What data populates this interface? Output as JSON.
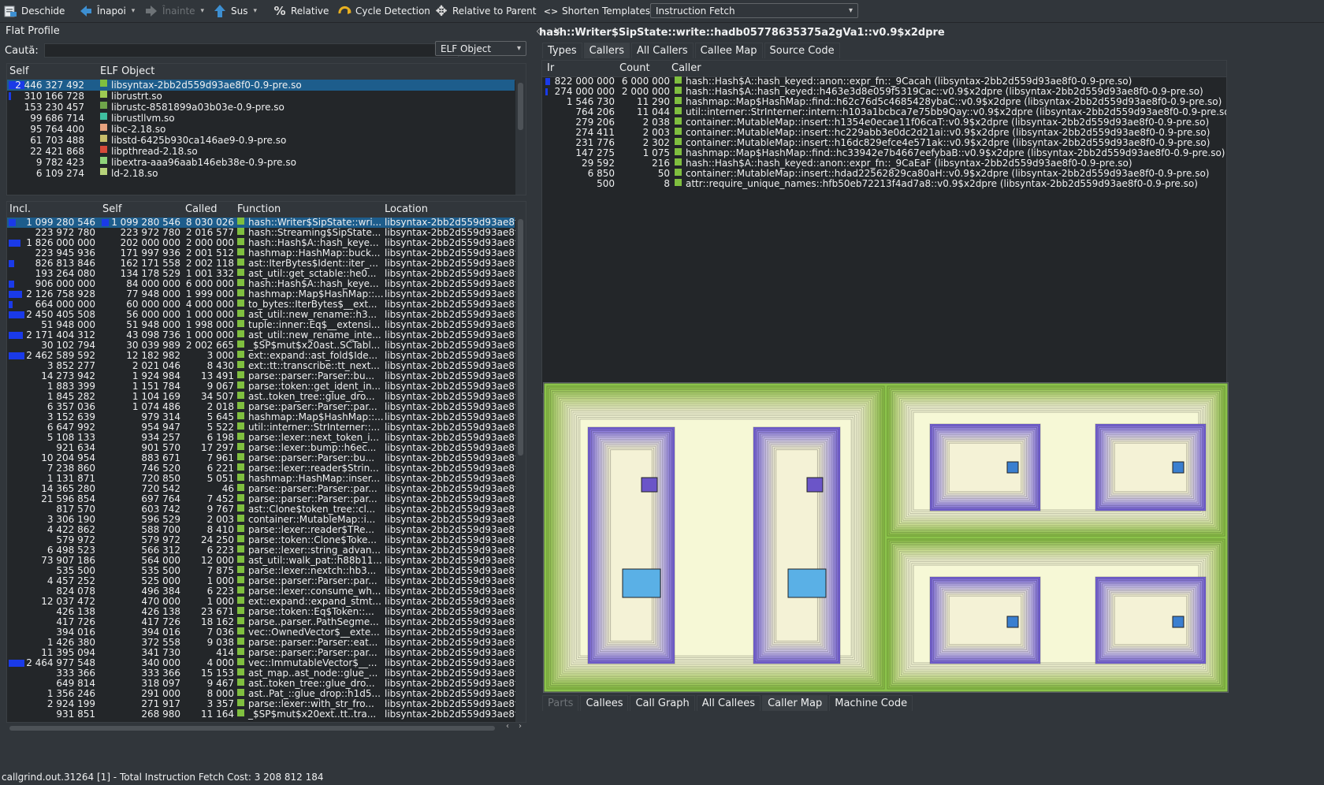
{
  "toolbar": {
    "open": "Deschide",
    "back": "Înapoi",
    "forward": "Înainte",
    "up": "Sus",
    "relative": "Relative",
    "cycle": "Cycle Detection",
    "relparent": "Relative to Parent",
    "shorten": "Shorten Templates",
    "event_type": "Instruction Fetch"
  },
  "left": {
    "title": "Flat Profile",
    "search_label": "Caută:",
    "search_value": "",
    "group_combo": "ELF Object",
    "objects_header": {
      "self": "Self",
      "obj": "ELF Object"
    },
    "objects": [
      {
        "self": "2 446 327 492",
        "name": "libsyntax-2bb2d559d93ae8f0-0.9-pre.so",
        "color": "#7fbf3f",
        "bar": 0.76
      },
      {
        "self": "310 166 728",
        "name": "librustrt.so",
        "color": "#9ecb52",
        "bar": 0.1
      },
      {
        "self": "153 230 457",
        "name": "librustc-8581899a03b03e-0.9-pre.so",
        "color": "#6fa44a",
        "bar": 0
      },
      {
        "self": "99 686 714",
        "name": "librustllvm.so",
        "color": "#3fbfa0",
        "bar": 0
      },
      {
        "self": "95 764 400",
        "name": "libc-2.18.so",
        "color": "#e6a27f",
        "bar": 0
      },
      {
        "self": "61 703 488",
        "name": "libstd-6425b930ca146ae9-0.9-pre.so",
        "color": "#c7bd6b",
        "bar": 0
      },
      {
        "self": "22 421 868",
        "name": "libpthread-2.18.so",
        "color": "#d64a3a",
        "bar": 0
      },
      {
        "self": "9 782 423",
        "name": "libextra-aaa96aab146eb38e-0.9-pre.so",
        "color": "#8fd47a",
        "bar": 0
      },
      {
        "self": "6 109 274",
        "name": "ld-2.18.so",
        "color": "#b7d37a",
        "bar": 0
      }
    ],
    "functions_header": {
      "incl": "Incl.",
      "self": "Self",
      "called": "Called",
      "func": "Function",
      "loc": "Location"
    },
    "functions": [
      {
        "incl": "1 099 280 546",
        "self": "1 099 280 546",
        "called": "8 030 026",
        "func": "hash::Writer$SipState::wri...",
        "loc": "libsyntax-2bb2d559d93ae8f",
        "ib": 0.34,
        "sb": 0.34
      },
      {
        "incl": "223 972 780",
        "self": "223 972 780",
        "called": "2 016 577",
        "func": "hash::Streaming$SipState...",
        "loc": "libsyntax-2bb2d559d93ae8f",
        "ib": 0,
        "sb": 0
      },
      {
        "incl": "1 826 000 000",
        "self": "202 000 000",
        "called": "2 000 000",
        "func": "hash::Hash$A::hash_keye...",
        "loc": "libsyntax-2bb2d559d93ae8f",
        "ib": 0.57,
        "sb": 0
      },
      {
        "incl": "223 945 936",
        "self": "171 997 936",
        "called": "2 001 512",
        "func": "hashmap::HashMap::buck...",
        "loc": "libsyntax-2bb2d559d93ae8f",
        "ib": 0,
        "sb": 0
      },
      {
        "incl": "826 813 846",
        "self": "162 171 558",
        "called": "2 002 118",
        "func": "ast::IterBytes$Ident::iter_...",
        "loc": "libsyntax-2bb2d559d93ae8f",
        "ib": 0.26,
        "sb": 0
      },
      {
        "incl": "193 264 080",
        "self": "134 178 529",
        "called": "1 001 332",
        "func": "ast_util::get_sctable::he0...",
        "loc": "libsyntax-2bb2d559d93ae8f",
        "ib": 0,
        "sb": 0
      },
      {
        "incl": "906 000 000",
        "self": "84 000 000",
        "called": "6 000 000",
        "func": "hash::Hash$A::hash_keye...",
        "loc": "libsyntax-2bb2d559d93ae8f",
        "ib": 0.28,
        "sb": 0
      },
      {
        "incl": "2 126 758 928",
        "self": "77 948 000",
        "called": "1 999 000",
        "func": "hashmap::Map$HashMap::...",
        "loc": "libsyntax-2bb2d559d93ae8f",
        "ib": 0.66,
        "sb": 0
      },
      {
        "incl": "664 000 000",
        "self": "60 000 000",
        "called": "4 000 000",
        "func": "to_bytes::IterBytes$__ext...",
        "loc": "libsyntax-2bb2d559d93ae8f",
        "ib": 0.21,
        "sb": 0
      },
      {
        "incl": "2 450 405 508",
        "self": "56 000 000",
        "called": "1 000 000",
        "func": "ast_util::new_rename::h3...",
        "loc": "libsyntax-2bb2d559d93ae8f",
        "ib": 0.76,
        "sb": 0
      },
      {
        "incl": "51 948 000",
        "self": "51 948 000",
        "called": "1 998 000",
        "func": "tuple::inner::Eq$__extensi...",
        "loc": "libsyntax-2bb2d559d93ae8f",
        "ib": 0,
        "sb": 0
      },
      {
        "incl": "2 171 404 312",
        "self": "43 098 736",
        "called": "1 000 000",
        "func": "ast_util::new_rename_inte...",
        "loc": "libsyntax-2bb2d559d93ae8f",
        "ib": 0.68,
        "sb": 0
      },
      {
        "incl": "30 102 794",
        "self": "30 039 989",
        "called": "2 002 665",
        "func": "_$SP$mut$x20ast..SCTabl...",
        "loc": "libsyntax-2bb2d559d93ae8f",
        "ib": 0,
        "sb": 0
      },
      {
        "incl": "2 462 589 592",
        "self": "12 182 982",
        "called": "3 000",
        "func": "ext::expand::ast_fold$Ide...",
        "loc": "libsyntax-2bb2d559d93ae8f",
        "ib": 0.77,
        "sb": 0
      },
      {
        "incl": "3 852 277",
        "self": "2 021 046",
        "called": "8 430",
        "func": "ext::tt::transcribe::tt_next...",
        "loc": "libsyntax-2bb2d559d93ae8f",
        "ib": 0,
        "sb": 0
      },
      {
        "incl": "14 273 942",
        "self": "1 924 984",
        "called": "13 491",
        "func": "parse::parser::Parser::bu...",
        "loc": "libsyntax-2bb2d559d93ae8f",
        "ib": 0,
        "sb": 0
      },
      {
        "incl": "1 883 399",
        "self": "1 151 784",
        "called": "9 067",
        "func": "parse::token::get_ident_in...",
        "loc": "libsyntax-2bb2d559d93ae8f",
        "ib": 0,
        "sb": 0
      },
      {
        "incl": "1 845 282",
        "self": "1 104 169",
        "called": "34 507",
        "func": "ast..token_tree::glue_dro...",
        "loc": "libsyntax-2bb2d559d93ae8f",
        "ib": 0,
        "sb": 0
      },
      {
        "incl": "6 357 036",
        "self": "1 074 486",
        "called": "2 018",
        "func": "parse::parser::Parser::par...",
        "loc": "libsyntax-2bb2d559d93ae8f",
        "ib": 0,
        "sb": 0
      },
      {
        "incl": "3 152 639",
        "self": "979 314",
        "called": "5 645",
        "func": "hashmap::Map$HashMap::...",
        "loc": "libsyntax-2bb2d559d93ae8f",
        "ib": 0,
        "sb": 0
      },
      {
        "incl": "6 647 992",
        "self": "954 947",
        "called": "5 522",
        "func": "util::interner::StrInterner::...",
        "loc": "libsyntax-2bb2d559d93ae8f",
        "ib": 0,
        "sb": 0
      },
      {
        "incl": "5 108 133",
        "self": "934 257",
        "called": "6 198",
        "func": "parse::lexer::next_token_i...",
        "loc": "libsyntax-2bb2d559d93ae8f",
        "ib": 0,
        "sb": 0
      },
      {
        "incl": "921 634",
        "self": "901 570",
        "called": "17 297",
        "func": "parse::lexer::bump::h6ec...",
        "loc": "libsyntax-2bb2d559d93ae8f",
        "ib": 0,
        "sb": 0
      },
      {
        "incl": "10 204 954",
        "self": "883 671",
        "called": "7 961",
        "func": "parse::parser::Parser::bu...",
        "loc": "libsyntax-2bb2d559d93ae8f",
        "ib": 0,
        "sb": 0
      },
      {
        "incl": "7 238 860",
        "self": "746 520",
        "called": "6 221",
        "func": "parse::lexer::reader$Strin...",
        "loc": "libsyntax-2bb2d559d93ae8f",
        "ib": 0,
        "sb": 0
      },
      {
        "incl": "1 131 871",
        "self": "720 850",
        "called": "5 051",
        "func": "hashmap::HashMap::inser...",
        "loc": "libsyntax-2bb2d559d93ae8f",
        "ib": 0,
        "sb": 0
      },
      {
        "incl": "14 365 280",
        "self": "720 542",
        "called": "46",
        "func": "parse::parser::Parser::par...",
        "loc": "libsyntax-2bb2d559d93ae8f",
        "ib": 0,
        "sb": 0
      },
      {
        "incl": "21 596 854",
        "self": "697 764",
        "called": "7 452",
        "func": "parse::parser::Parser::par...",
        "loc": "libsyntax-2bb2d559d93ae8f",
        "ib": 0,
        "sb": 0
      },
      {
        "incl": "817 570",
        "self": "603 742",
        "called": "9 767",
        "func": "ast::Clone$token_tree::cl...",
        "loc": "libsyntax-2bb2d559d93ae8f",
        "ib": 0,
        "sb": 0
      },
      {
        "incl": "3 306 190",
        "self": "596 529",
        "called": "2 003",
        "func": "container::MutableMap::i...",
        "loc": "libsyntax-2bb2d559d93ae8f",
        "ib": 0,
        "sb": 0
      },
      {
        "incl": "4 422 862",
        "self": "588 700",
        "called": "8 410",
        "func": "parse::lexer::reader$TRe...",
        "loc": "libsyntax-2bb2d559d93ae8f",
        "ib": 0,
        "sb": 0
      },
      {
        "incl": "579 972",
        "self": "579 972",
        "called": "24 250",
        "func": "parse::token::Clone$Toke...",
        "loc": "libsyntax-2bb2d559d93ae8f",
        "ib": 0,
        "sb": 0
      },
      {
        "incl": "6 498 523",
        "self": "566 312",
        "called": "6 223",
        "func": "parse::lexer::string_advan...",
        "loc": "libsyntax-2bb2d559d93ae8f",
        "ib": 0,
        "sb": 0
      },
      {
        "incl": "73 907 186",
        "self": "564 000",
        "called": "12 000",
        "func": "ast_util::walk_pat::h88b11...",
        "loc": "libsyntax-2bb2d559d93ae8f",
        "ib": 0,
        "sb": 0
      },
      {
        "incl": "535 500",
        "self": "535 500",
        "called": "7 875",
        "func": "parse::lexer::nextch::hb3...",
        "loc": "libsyntax-2bb2d559d93ae8f",
        "ib": 0,
        "sb": 0
      },
      {
        "incl": "4 457 252",
        "self": "525 000",
        "called": "1 000",
        "func": "parse::parser::Parser::par...",
        "loc": "libsyntax-2bb2d559d93ae8f",
        "ib": 0,
        "sb": 0
      },
      {
        "incl": "824 078",
        "self": "496 384",
        "called": "6 223",
        "func": "parse::lexer::consume_wh...",
        "loc": "libsyntax-2bb2d559d93ae8f",
        "ib": 0,
        "sb": 0
      },
      {
        "incl": "12 037 472",
        "self": "470 000",
        "called": "1 000",
        "func": "ext::expand::expand_stmt...",
        "loc": "libsyntax-2bb2d559d93ae8f",
        "ib": 0,
        "sb": 0
      },
      {
        "incl": "426 138",
        "self": "426 138",
        "called": "23 671",
        "func": "parse::token::Eq$Token::...",
        "loc": "libsyntax-2bb2d559d93ae8f",
        "ib": 0,
        "sb": 0
      },
      {
        "incl": "417 726",
        "self": "417 726",
        "called": "18 162",
        "func": "parse..parser..PathSegme...",
        "loc": "libsyntax-2bb2d559d93ae8f",
        "ib": 0,
        "sb": 0
      },
      {
        "incl": "394 016",
        "self": "394 016",
        "called": "7 036",
        "func": "vec::OwnedVector$__exte...",
        "loc": "libsyntax-2bb2d559d93ae8f",
        "ib": 0,
        "sb": 0
      },
      {
        "incl": "1 426 380",
        "self": "372 558",
        "called": "9 038",
        "func": "parse::parser::Parser::eat...",
        "loc": "libsyntax-2bb2d559d93ae8f",
        "ib": 0,
        "sb": 0
      },
      {
        "incl": "11 395 094",
        "self": "341 730",
        "called": "414",
        "func": "parse::parser::Parser::par...",
        "loc": "libsyntax-2bb2d559d93ae8f",
        "ib": 0,
        "sb": 0
      },
      {
        "incl": "2 464 977 548",
        "self": "340 000",
        "called": "4 000",
        "func": "vec::ImmutableVector$__...",
        "loc": "libsyntax-2bb2d559d93ae8f",
        "ib": 0.77,
        "sb": 0
      },
      {
        "incl": "333 366",
        "self": "333 366",
        "called": "15 153",
        "func": "ast_map..ast_node::glue_...",
        "loc": "libsyntax-2bb2d559d93ae8f",
        "ib": 0,
        "sb": 0
      },
      {
        "incl": "649 814",
        "self": "318 097",
        "called": "9 467",
        "func": "ast..token_tree::glue_dro...",
        "loc": "libsyntax-2bb2d559d93ae8f",
        "ib": 0,
        "sb": 0
      },
      {
        "incl": "1 356 246",
        "self": "291 000",
        "called": "8 000",
        "func": "ast..Pat_::glue_drop::h1d5...",
        "loc": "libsyntax-2bb2d559d93ae8f",
        "ib": 0,
        "sb": 0
      },
      {
        "incl": "2 924 199",
        "self": "271 917",
        "called": "3 357",
        "func": "parse::lexer::with_str_fro...",
        "loc": "libsyntax-2bb2d559d93ae8f",
        "ib": 0,
        "sb": 0
      },
      {
        "incl": "931 851",
        "self": "268 980",
        "called": "11 164",
        "func": "_$SP$mut$x20ext..tt..tra...",
        "loc": "libsyntax-2bb2d559d93ae8f",
        "ib": 0,
        "sb": 0
      }
    ]
  },
  "right": {
    "title": "hash::Writer$SipState::write::hadb05778635375a2gVa1::v0.9$x2dpre",
    "top_tabs": [
      "Types",
      "Callers",
      "All Callers",
      "Callee Map",
      "Source Code"
    ],
    "top_active": 1,
    "callers_header": {
      "ir": "Ir",
      "count": "Count",
      "caller": "Caller"
    },
    "callers": [
      {
        "ir": "822 000 000",
        "count": "6 000 000",
        "caller": "hash::Hash$A::hash_keyed::anon::expr_fn::_9Cacah (libsyntax-2bb2d559d93ae8f0-0.9-pre.so)",
        "bar": 0.75
      },
      {
        "ir": "274 000 000",
        "count": "2 000 000",
        "caller": "hash::Hash$A::hash_keyed::h463e3d8e059f5319Cac::v0.9$x2dpre (libsyntax-2bb2d559d93ae8f0-0.9-pre.so)",
        "bar": 0.25
      },
      {
        "ir": "1 546 730",
        "count": "11 290",
        "caller": "hashmap::Map$HashMap::find::h62c76d5c4685428ybaC::v0.9$x2dpre (libsyntax-2bb2d559d93ae8f0-0.9-pre.so)",
        "bar": 0
      },
      {
        "ir": "764 206",
        "count": "11 044",
        "caller": "util::interner::StrInterner::intern::h103a1bcbca7e75bb9Qay::v0.9$x2dpre (libsyntax-2bb2d559d93ae8f0-0.9-pre.so)",
        "bar": 0
      },
      {
        "ir": "279 206",
        "count": "2 038",
        "caller": "container::MutableMap::insert::h1354e0ecae11f06caT::v0.9$x2dpre (libsyntax-2bb2d559d93ae8f0-0.9-pre.so)",
        "bar": 0
      },
      {
        "ir": "274 411",
        "count": "2 003",
        "caller": "container::MutableMap::insert::hc229abb3e0dc2d21ai::v0.9$x2dpre (libsyntax-2bb2d559d93ae8f0-0.9-pre.so)",
        "bar": 0
      },
      {
        "ir": "231 776",
        "count": "2 302",
        "caller": "container::MutableMap::insert::h16dc829efce4e571ak::v0.9$x2dpre (libsyntax-2bb2d559d93ae8f0-0.9-pre.so)",
        "bar": 0
      },
      {
        "ir": "147 275",
        "count": "1 075",
        "caller": "hashmap::Map$HashMap::find::hc33942e7b4667eefybaB::v0.9$x2dpre (libsyntax-2bb2d559d93ae8f0-0.9-pre.so)",
        "bar": 0
      },
      {
        "ir": "29 592",
        "count": "216",
        "caller": "hash::Hash$A::hash_keyed::anon::expr_fn::_9CaEaF (libsyntax-2bb2d559d93ae8f0-0.9-pre.so)",
        "bar": 0
      },
      {
        "ir": "6 850",
        "count": "50",
        "caller": "container::MutableMap::insert::hdad22562829ca80aH::v0.9$x2dpre (libsyntax-2bb2d559d93ae8f0-0.9-pre.so)",
        "bar": 0
      },
      {
        "ir": "500",
        "count": "8",
        "caller": "attr::require_unique_names::hfb50eb72213f4ad7a8::v0.9$x2dpre (libsyntax-2bb2d559d93ae8f0-0.9-pre.so)",
        "bar": 0
      }
    ],
    "bottom_tabs": [
      "Parts",
      "Callees",
      "Call Graph",
      "All Callees",
      "Caller Map",
      "Machine Code"
    ],
    "bottom_active": 4,
    "bottom_disabled": 0
  },
  "status": "callgrind.out.31264 [1] - Total Instruction Fetch Cost: 3 208 812 184",
  "colors": {
    "lib_green": "#7fbf3f",
    "bar_blue": "#1a3ae8",
    "selection": "#1d5d8c",
    "map_green": "#8bc34a",
    "map_purple": "#8a6fe0",
    "map_cream": "#f3f5d0"
  }
}
